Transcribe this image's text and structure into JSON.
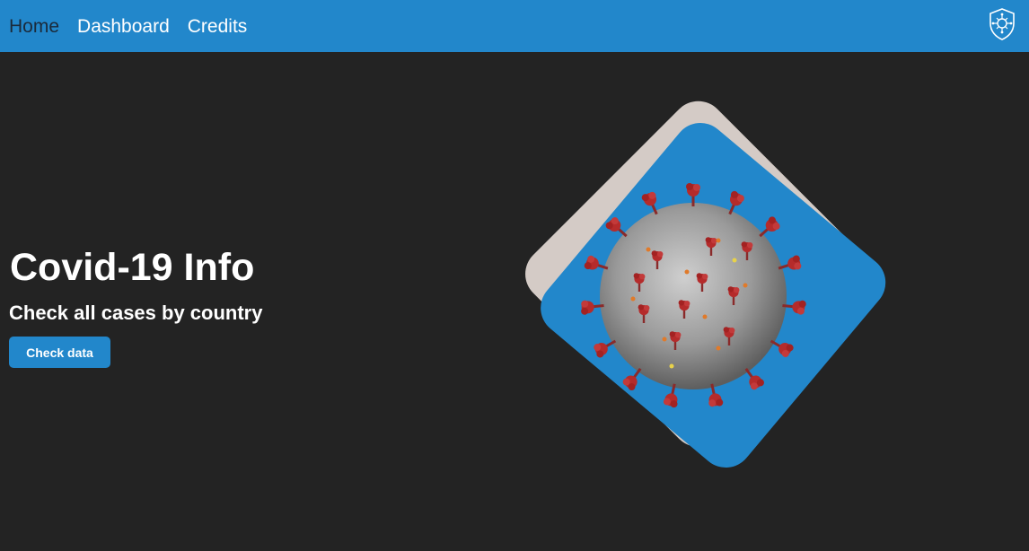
{
  "navbar": {
    "links": [
      {
        "label": "Home",
        "active": true
      },
      {
        "label": "Dashboard",
        "active": false
      },
      {
        "label": "Credits",
        "active": false
      }
    ],
    "logo_icon": "virus-shield-icon"
  },
  "hero": {
    "title": "Covid-19 Info",
    "subtitle": "Check all cases by country",
    "button_label": "Check data",
    "illustration": "coronavirus-illustration"
  },
  "colors": {
    "navbar": "#2287cb",
    "background": "#232323",
    "card_back": "#d4cbc6",
    "card_front": "#2287cb",
    "virus_body": "#9a9a9a",
    "virus_spike": "#b02a2a"
  }
}
